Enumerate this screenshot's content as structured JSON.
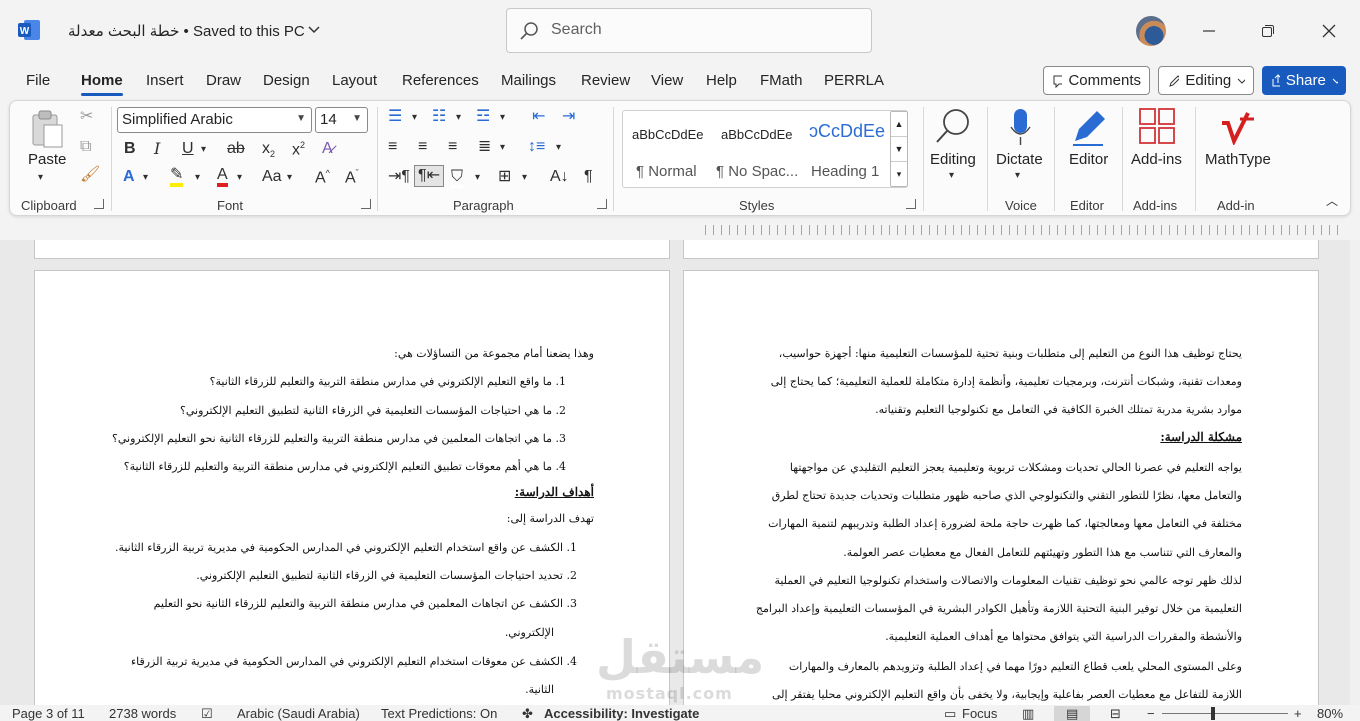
{
  "titlebar": {
    "doc_title": "خطة البحث معدلة • Saved to this PC",
    "search_placeholder": "Search"
  },
  "menu": {
    "tabs": [
      "File",
      "Home",
      "Insert",
      "Draw",
      "Design",
      "Layout",
      "References",
      "Mailings",
      "Review",
      "View",
      "Help",
      "FMath",
      "PERRLA"
    ],
    "comments": "Comments",
    "editing": "Editing",
    "share": "Share"
  },
  "ribbon": {
    "clipboard": {
      "paste": "Paste",
      "label": "Clipboard"
    },
    "font": {
      "name": "Simplified Arabic",
      "size": "14",
      "label": "Font"
    },
    "paragraph": {
      "label": "Paragraph"
    },
    "styles": {
      "label": "Styles",
      "items": [
        {
          "preview": "aBbCcDdEe",
          "name": "¶ Normal"
        },
        {
          "preview": "aBbCcDdEe",
          "name": "¶ No Spac..."
        },
        {
          "preview": "ɔCcDdEe",
          "name": "Heading 1"
        }
      ]
    },
    "editing_btn": "Editing",
    "dictate": "Dictate",
    "voice_label": "Voice",
    "editor": "Editor",
    "editor_label": "Editor",
    "addins": "Add-ins",
    "addins_label": "Add-ins",
    "mathtype": "MathType",
    "addin_label": "Add-in"
  },
  "doc": {
    "right_page": [
      "يحتاج توظيف هذا النوع من التعليم إلى متطلبات وبنية تحتية للمؤسسات التعليمية منها: أجهزة حواسيب،",
      "ومعدات تقنية، وشبكات أنترنت، وبرمجيات تعليمية، وأنظمة إدارة متكاملة للعملية التعليمية؛ كما يحتاج إلى",
      "موارد بشرية مدربة تمتلك الخبرة الكافية في التعامل مع تكنولوجيا التعليم وتقنياته.",
      "مشكلة الدراسة:",
      "يواجه التعليم في عصرنا الحالي تحديات ومشكلات تربوية وتعليمية يعجز التعليم التقليدي عن مواجهتها",
      "والتعامل معها، نظرًا للتطور التقني والتكنولوجي الذي صاحبه ظهور متطلبات وتحديات جديدة تحتاج لطرق",
      "مختلفة في التعامل معها ومعالجتها، كما ظهرت حاجة ملحة لضرورة إعداد الطلبة وتدريبهم لتنمية المهارات",
      "والمعارف التي تتناسب مع هذا التطور وتهيئتهم للتعامل الفعال مع معطيات عصر العولمة.",
      "لذلك ظهر توجه عالمي نحو توظيف تقنيات المعلومات والاتصالات واستخدام تكنولوجيا التعليم في العملية",
      "التعليمية من خلال توفير البنية التحتية اللازمة وتأهيل الكوادر البشرية في المؤسسات التعليمية وإعداد البرامج",
      "والأنشطة والمقررات الدراسية التي يتوافق محتواها مع أهداف العملية التعليمية.",
      "وعلى المستوى المحلي يلعب قطاع التعليم دورًا مهما في إعداد الطلبة وتزويدهم بالمعارف والمهارات",
      "اللازمة للتفاعل مع معطيات العصر بفاعلية وإيجابية، ولا يخفى بأن واقع التعليم الإلكتروني محليا يفتقر إلى"
    ],
    "left_page": [
      "وهذا يضعنا أمام مجموعة من التساؤلات هي:",
      "1.  ما واقع التعليم الإلكتروني في مدارس منطقة التربية والتعليم للزرقاء الثانية؟",
      "2.  ما هي احتياجات المؤسسات التعليمية في الزرقاء الثانية لتطبيق التعليم الإلكتروني؟",
      "3.  ما هي اتجاهات المعلمين في مدارس منطقة التربية والتعليم للزرقاء الثانية نحو التعليم الإلكتروني؟",
      "4.  ما هي أهم معوقات تطبيق التعليم الإلكتروني في مدارس منطقة التربية والتعليم للزرقاء الثانية؟",
      "أهداف الدراسة:",
      "تهدف الدراسة إلى:",
      "1.  الكشف عن واقع استخدام التعليم الإلكتروني في المدارس الحكومية في مديرية تربية الزرقاء الثانية.",
      "2.  تحديد احتياجات المؤسسات التعليمية في الزرقاء الثانية لتطبيق التعليم الإلكتروني.",
      "3.  الكشف عن اتجاهات المعلمين في مدارس منطقة التربية والتعليم للزرقاء الثانية نحو التعليم",
      "الإلكتروني.",
      "4.  الكشف عن معوقات استخدام التعليم الإلكتروني في المدارس الحكومية في مديرية تربية الزرقاء",
      "الثانية."
    ],
    "watermark": "مستقل",
    "watermark_small": "mostaql.com"
  },
  "status": {
    "page": "Page 3 of 11",
    "words": "2738 words",
    "language": "Arabic (Saudi Arabia)",
    "predictions": "Text Predictions: On",
    "accessibility": "Accessibility: Investigate",
    "focus": "Focus",
    "zoom": "80%"
  }
}
